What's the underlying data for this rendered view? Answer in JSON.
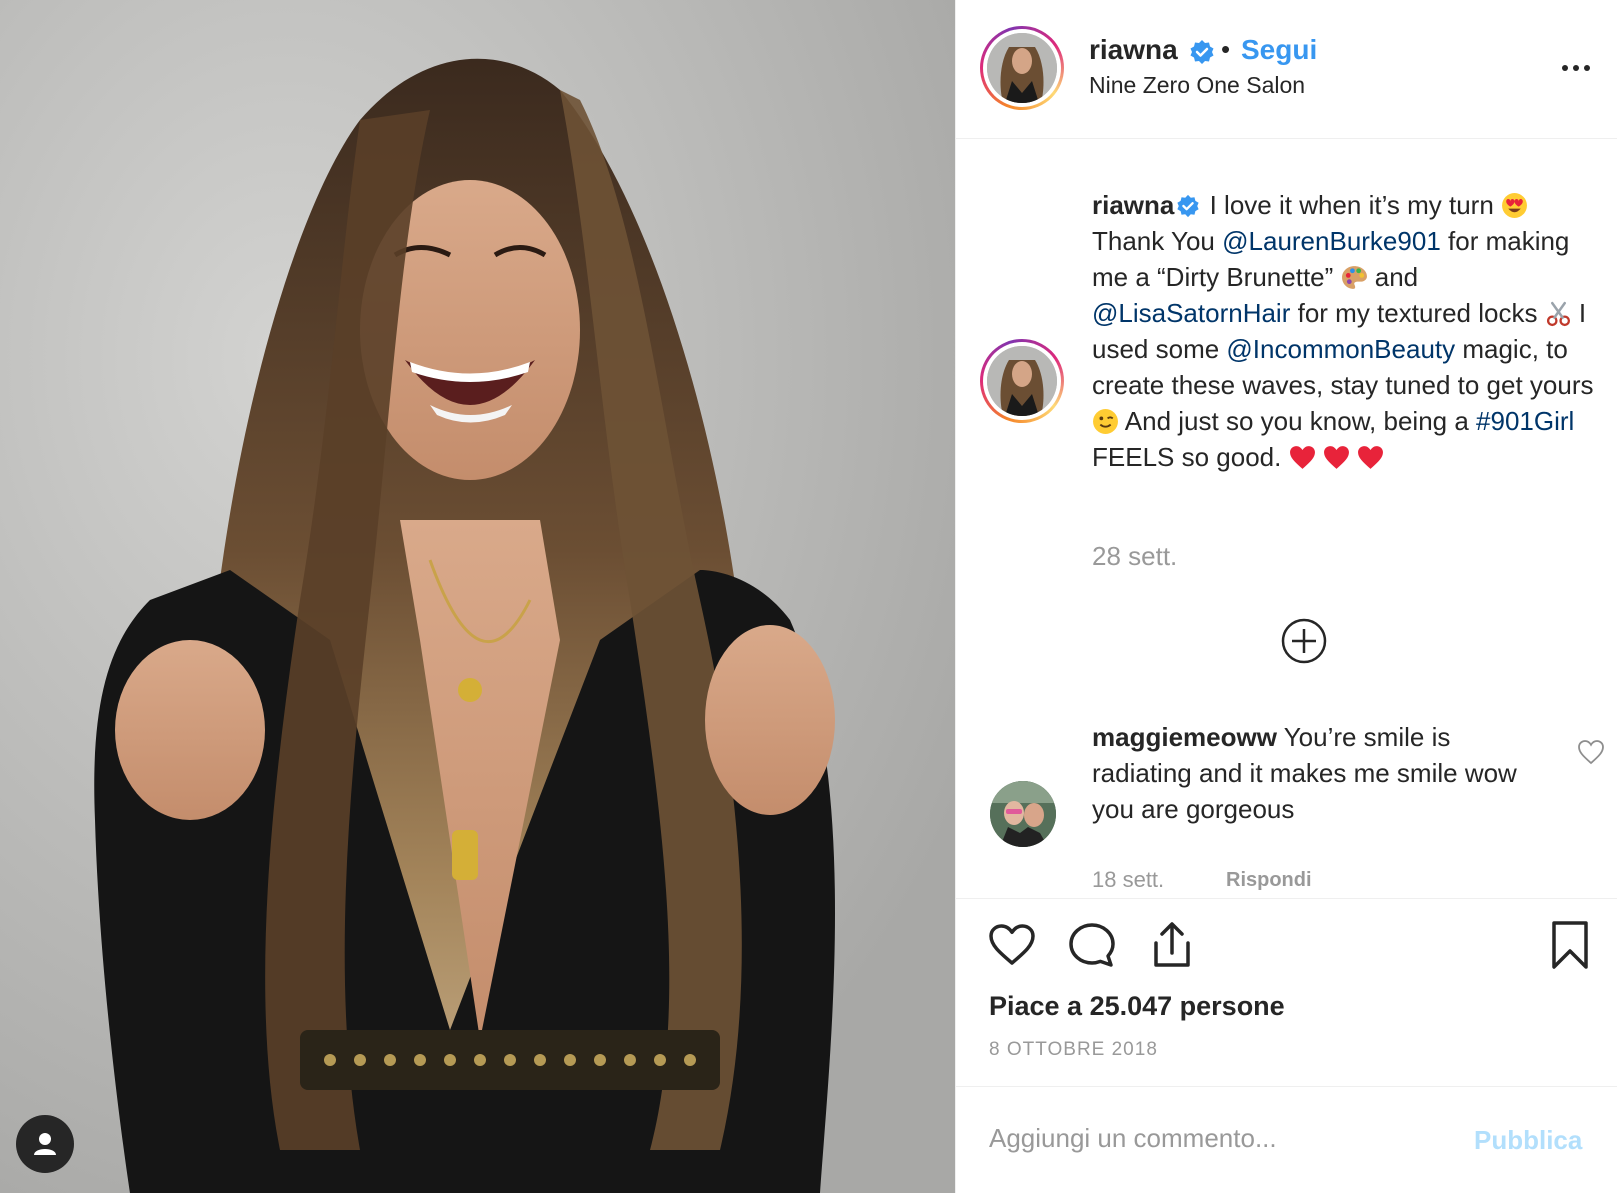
{
  "post": {
    "owner": {
      "username": "riawna",
      "verified": true,
      "separator": "•",
      "follow_label": "Segui",
      "location": "Nine Zero One Salon"
    },
    "more_icon": "more-horizontal-icon",
    "caption": {
      "username": "riawna",
      "parts": [
        {
          "type": "text",
          "text": " I love it when it’s my turn "
        },
        {
          "type": "emoji",
          "name": "heart-eyes-emoji"
        },
        {
          "type": "text",
          "text": " Thank You "
        },
        {
          "type": "mention",
          "text": "@LaurenBurke901"
        },
        {
          "type": "text",
          "text": " for making me a “Dirty Brunette” "
        },
        {
          "type": "emoji",
          "name": "palette-emoji"
        },
        {
          "type": "text",
          "text": "  and "
        },
        {
          "type": "mention",
          "text": "@LisaSatornHair"
        },
        {
          "type": "text",
          "text": " for my textured locks "
        },
        {
          "type": "emoji",
          "name": "scissors-emoji"
        },
        {
          "type": "text",
          "text": "  I used some "
        },
        {
          "type": "mention",
          "text": "@IncommonBeauty"
        },
        {
          "type": "text",
          "text": " magic, to create these waves, stay tuned to get yours "
        },
        {
          "type": "emoji",
          "name": "wink-emoji"
        },
        {
          "type": "text",
          "text": "  And just so you know, being a "
        },
        {
          "type": "mention",
          "text": "#901Girl"
        },
        {
          "type": "text",
          "text": " FEELS so good. "
        },
        {
          "type": "emoji",
          "name": "red-heart-emoji"
        },
        {
          "type": "emoji",
          "name": "red-heart-emoji"
        },
        {
          "type": "emoji",
          "name": "red-heart-emoji"
        }
      ],
      "time": "28 sett."
    },
    "load_more_icon": "plus-circle-icon",
    "comments": [
      {
        "username": "maggiemeoww",
        "text": " You’re smile is radiating and it makes me smile wow you are gorgeous",
        "time": "18 sett.",
        "reply_label": "Rispondi",
        "like_icon": "heart-outline-icon"
      }
    ],
    "actions": {
      "like_icon": "heart-outline-icon",
      "comment_icon": "comment-bubble-icon",
      "share_icon": "share-upload-icon",
      "save_icon": "bookmark-icon"
    },
    "likes_text": "Piace a 25.047 persone",
    "date": "8 OTTOBRE 2018",
    "comment_box": {
      "placeholder": "Aggiungi un commento...",
      "publish_label": "Pubblica"
    }
  },
  "colors": {
    "accent": "#3897f0",
    "mention": "#003569",
    "muted": "#999999",
    "publish_disabled": "#b2dffc",
    "text": "#262626"
  }
}
